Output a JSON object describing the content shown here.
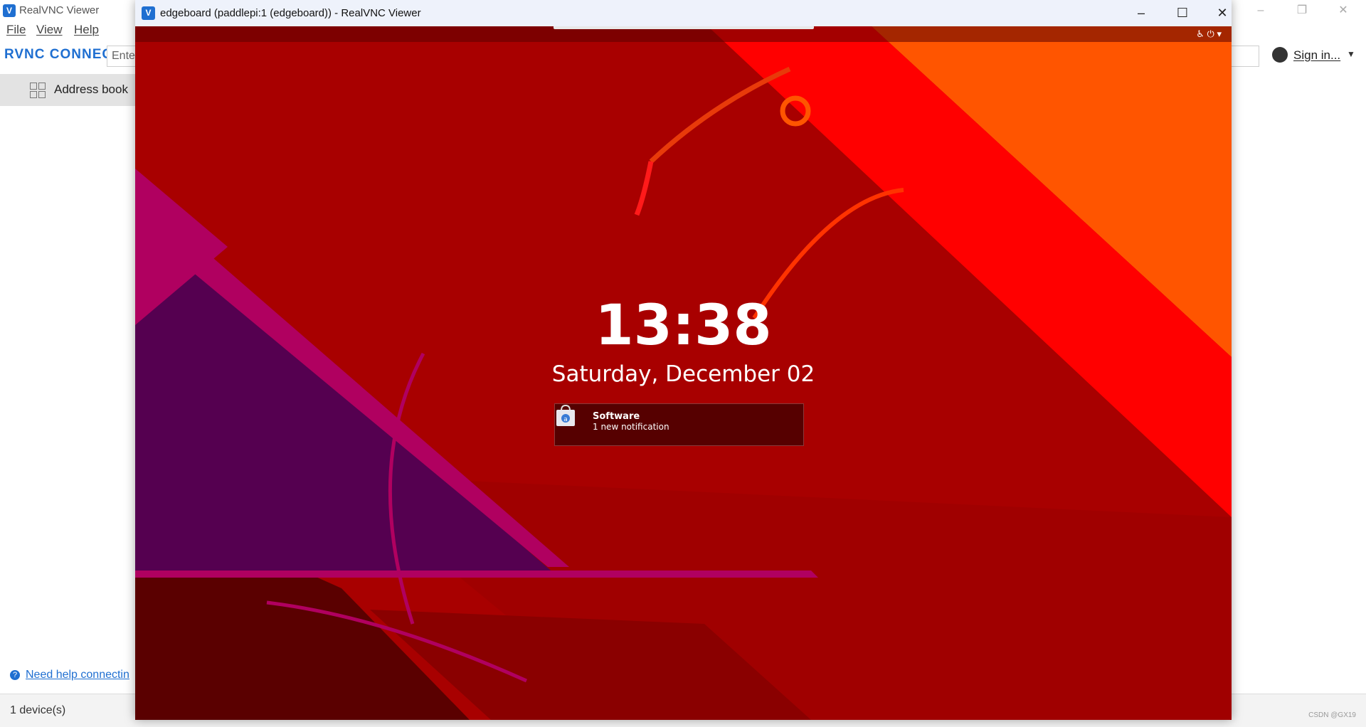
{
  "background_app": {
    "title": "RealVNC Viewer",
    "menu": [
      "File",
      "View",
      "Help"
    ],
    "logo": "RVNC CONNECT",
    "search_value": "Enter",
    "signin_label": "Sign in...",
    "sidebar_item": "Address book",
    "help_link": "Need help connectin",
    "status": "1 device(s)",
    "watermark": "CSDN @GX19"
  },
  "vnc_window": {
    "title": "edgeboard (paddlepi:1 (edgeboard)) - RealVNC Viewer",
    "controls": [
      "minimize",
      "maximize",
      "close"
    ]
  },
  "lock_screen": {
    "time": "13:38",
    "date": "Saturday, December 02",
    "notification": {
      "app": "Software",
      "text": "1 new notification",
      "icon": "software-bag-icon"
    },
    "system_icons": [
      "accessibility-icon",
      "power-icon",
      "chevron-down-icon"
    ]
  },
  "colors": {
    "wallpaper_base": "#a80000",
    "wallpaper_orange": "#ff5500",
    "wallpaper_red": "#ff0000",
    "wallpaper_purple": "#550050",
    "wallpaper_magenta": "#b00060",
    "accent_blue": "#1f6fd1"
  }
}
